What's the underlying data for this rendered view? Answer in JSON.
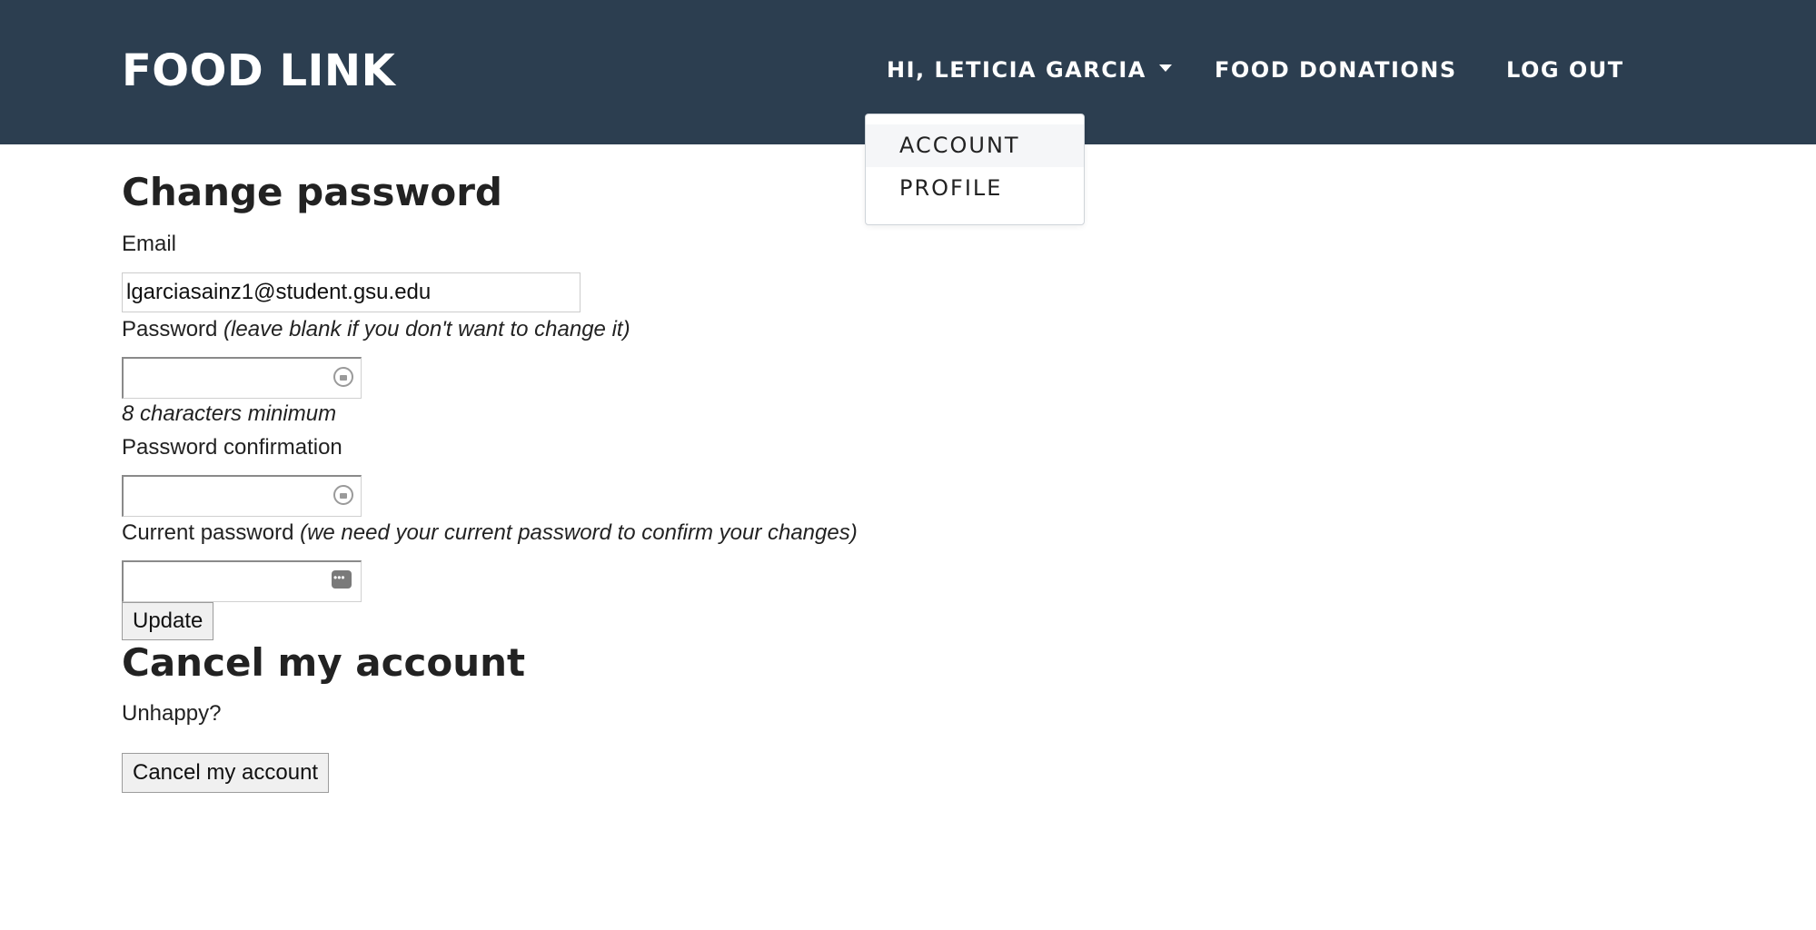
{
  "colors": {
    "navbar_bg": "#2c3e50",
    "navbar_text": "#ffffff",
    "page_bg": "#ffffff",
    "text": "#222222"
  },
  "navbar": {
    "brand": "FOOD LINK",
    "user_menu_label": "HI, LETICIA GARCIA",
    "food_donations": "FOOD DONATIONS",
    "log_out": "LOG OUT"
  },
  "user_dropdown": {
    "items": [
      {
        "label": "ACCOUNT",
        "highlighted": true
      },
      {
        "label": "PROFILE",
        "highlighted": false
      }
    ]
  },
  "change_password": {
    "heading": "Change password",
    "email_label": "Email",
    "email_value": "lgarciasainz1@student.gsu.edu",
    "password_label": "Password",
    "password_hint": "(leave blank if you don't want to change it)",
    "password_min_note": "8 characters minimum",
    "password_confirmation_label": "Password confirmation",
    "current_password_label": "Current password",
    "current_password_hint": "(we need your current password to confirm your changes)",
    "update_button": "Update"
  },
  "cancel_account": {
    "heading": "Cancel my account",
    "prompt": "Unhappy?",
    "button": "Cancel my account"
  },
  "icons": {
    "password_field_icon": "password-manager-icon",
    "current_password_field_icon": "key-icon"
  }
}
